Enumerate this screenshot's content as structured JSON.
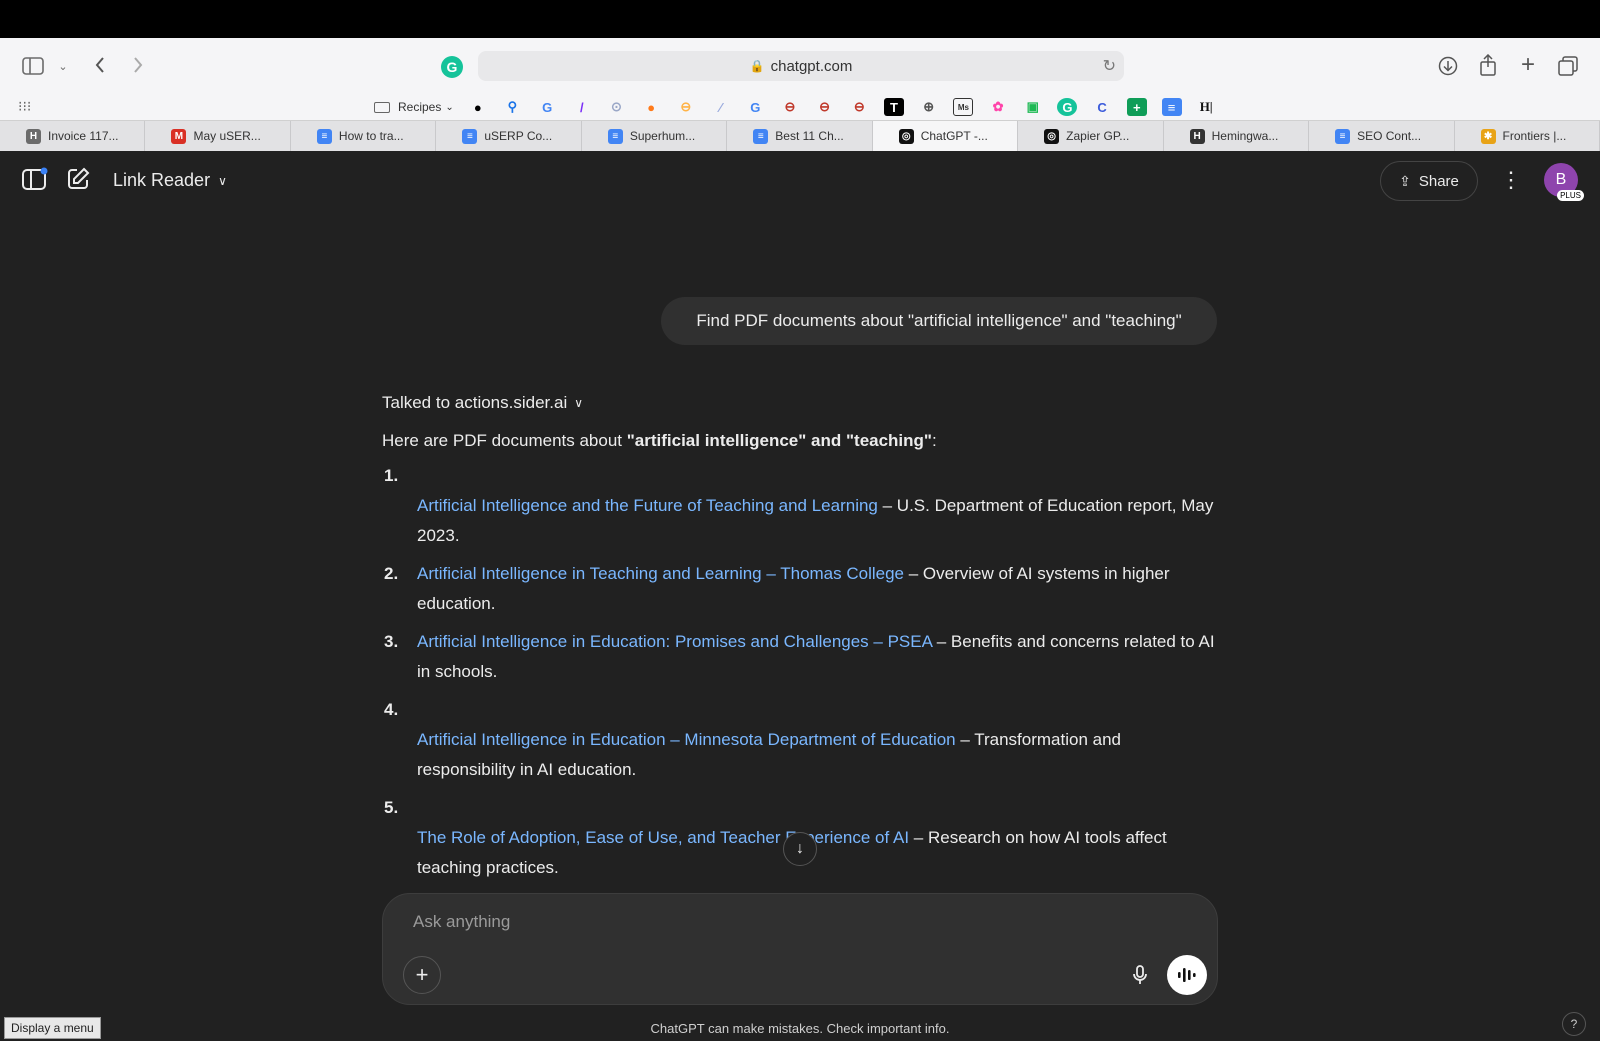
{
  "browser": {
    "url": "chatgpt.com",
    "bookmark_folder": "Recipes",
    "tabs": [
      {
        "label": "Invoice 117...",
        "icon": "H",
        "color": "#6b6b6b",
        "active": false
      },
      {
        "label": "May uSER...",
        "icon": "M",
        "color": "#d93025",
        "active": false
      },
      {
        "label": "How to tra...",
        "icon": "≡",
        "color": "#4285f4",
        "active": false
      },
      {
        "label": "uSERP Co...",
        "icon": "≡",
        "color": "#4285f4",
        "active": false
      },
      {
        "label": "Superhum...",
        "icon": "≡",
        "color": "#4285f4",
        "active": false
      },
      {
        "label": "Best 11 Ch...",
        "icon": "≡",
        "color": "#4285f4",
        "active": false
      },
      {
        "label": "ChatGPT -...",
        "icon": "◎",
        "color": "#111111",
        "active": true
      },
      {
        "label": "Zapier GP...",
        "icon": "◎",
        "color": "#111111",
        "active": false
      },
      {
        "label": "Hemingwa...",
        "icon": "H",
        "color": "#333333",
        "active": false
      },
      {
        "label": "SEO Cont...",
        "icon": "≡",
        "color": "#4285f4",
        "active": false
      },
      {
        "label": "Frontiers |...",
        "icon": "✱",
        "color": "#e8a317",
        "active": false
      }
    ]
  },
  "chat": {
    "model_name": "Link Reader",
    "share_label": "Share",
    "avatar_letter": "B",
    "avatar_badge": "PLUS",
    "user_message": "Find PDF documents about \"artificial intelligence\" and \"teaching\"",
    "tool_status": "Talked to actions.sider.ai",
    "intro_prefix": "Here are PDF documents about ",
    "intro_bold": "\"artificial intelligence\" and \"teaching\"",
    "intro_suffix": ":",
    "results": [
      {
        "num": "1.",
        "link": "Artificial Intelligence and the Future of Teaching and Learning",
        "desc": " – U.S. Department of Education report, May 2023."
      },
      {
        "num": "2.",
        "link": "Artificial Intelligence in Teaching and Learning – Thomas College",
        "desc": " – Overview of AI systems in higher education."
      },
      {
        "num": "3.",
        "link": "Artificial Intelligence in Education: Promises and Challenges – PSEA",
        "desc": " – Benefits and concerns related to AI in schools."
      },
      {
        "num": "4.",
        "link": "Artificial Intelligence in Education – Minnesota Department of Education",
        "desc": " – Transformation and responsibility in AI education."
      },
      {
        "num": "5.",
        "link": "The Role of Adoption, Ease of Use, and Teacher Experience of AI",
        "desc": " – Research on how AI tools affect teaching practices."
      }
    ],
    "composer_placeholder": "Ask anything",
    "disclaimer": "ChatGPT can make mistakes. Check important info.",
    "status_tooltip": "Display a menu",
    "help_label": "?"
  }
}
